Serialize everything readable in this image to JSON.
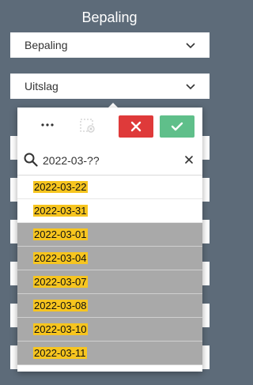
{
  "panel": {
    "title": "Bepaling"
  },
  "selects": [
    {
      "value": "Bepaling"
    },
    {
      "value": "Uitslag"
    }
  ],
  "popup": {
    "toolbar": {
      "more_icon": "ellipsis-icon",
      "clear_selection_icon": "clear-selection-icon",
      "cancel_icon": "close-icon",
      "confirm_icon": "check-icon"
    },
    "search": {
      "value": "2022-03-??",
      "search_icon": "search-icon",
      "clear_icon": "close-icon"
    },
    "items": [
      {
        "label": "2022-03-22",
        "state": "selected"
      },
      {
        "label": "2022-03-31",
        "state": "selected"
      },
      {
        "label": "2022-03-01",
        "state": "excluded"
      },
      {
        "label": "2022-03-04",
        "state": "excluded"
      },
      {
        "label": "2022-03-07",
        "state": "excluded"
      },
      {
        "label": "2022-03-08",
        "state": "excluded"
      },
      {
        "label": "2022-03-10",
        "state": "excluded"
      },
      {
        "label": "2022-03-11",
        "state": "excluded"
      }
    ]
  },
  "colors": {
    "background": "#5d6b79",
    "cancel": "#df3a3a",
    "confirm": "#5fbf8a",
    "highlight": "#f7c51f",
    "excluded_row": "#a9a9a9"
  }
}
